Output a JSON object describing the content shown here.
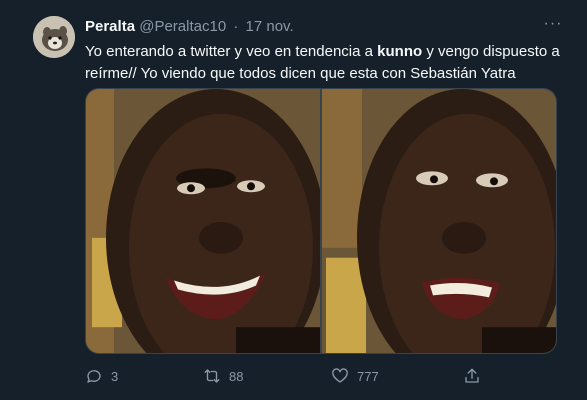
{
  "tweet": {
    "display_name": "Peralta",
    "handle": "@Peraltac10",
    "separator": "·",
    "date": "17 nov.",
    "text_part1": "Yo enterando a twitter y veo en tendencia a ",
    "text_bold": "kunno",
    "text_part2": " y vengo dispuesto a reírme// Yo viendo que todos dicen que esta con Sebastián Yatra",
    "more_icon": "···"
  },
  "actions": {
    "reply_count": "3",
    "retweet_count": "88",
    "like_count": "777"
  },
  "colors": {
    "background": "#15202b",
    "text_primary": "#f7f9f9",
    "text_secondary": "#8b98a5",
    "border": "#38444d"
  }
}
